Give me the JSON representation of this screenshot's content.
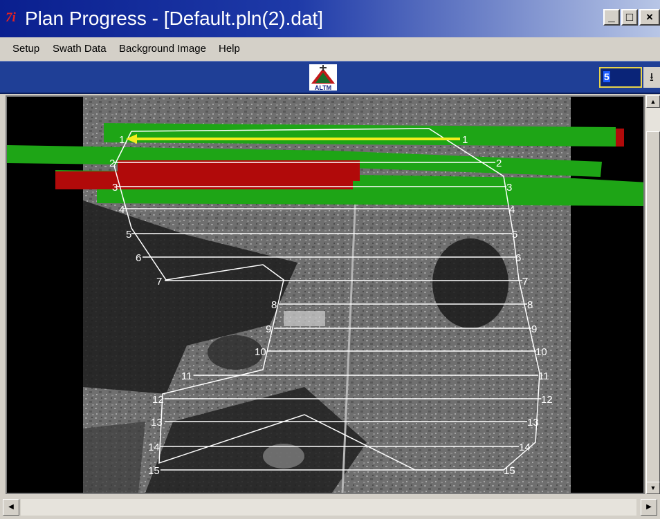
{
  "window": {
    "icon_text": "7i",
    "title": "Plan Progress - [Default.pln(2).dat]",
    "minimize": "_",
    "maximize": "□",
    "close": "×"
  },
  "menu": {
    "items": [
      "Setup",
      "Swath Data",
      "Background Image",
      "Help"
    ]
  },
  "toolbar": {
    "logo_text": "ALTM",
    "number_value": "5",
    "download_icon": "download-icon"
  },
  "map": {
    "line_labels": [
      "1",
      "2",
      "3",
      "4",
      "5",
      "6",
      "7",
      "8",
      "9",
      "10",
      "11",
      "12",
      "13",
      "14",
      "15"
    ],
    "colors": {
      "covered_swath": "#1ea516",
      "error_swath": "#b10a0a",
      "current_line": "#f2ee1c",
      "plan_lines": "#ffffff"
    }
  }
}
